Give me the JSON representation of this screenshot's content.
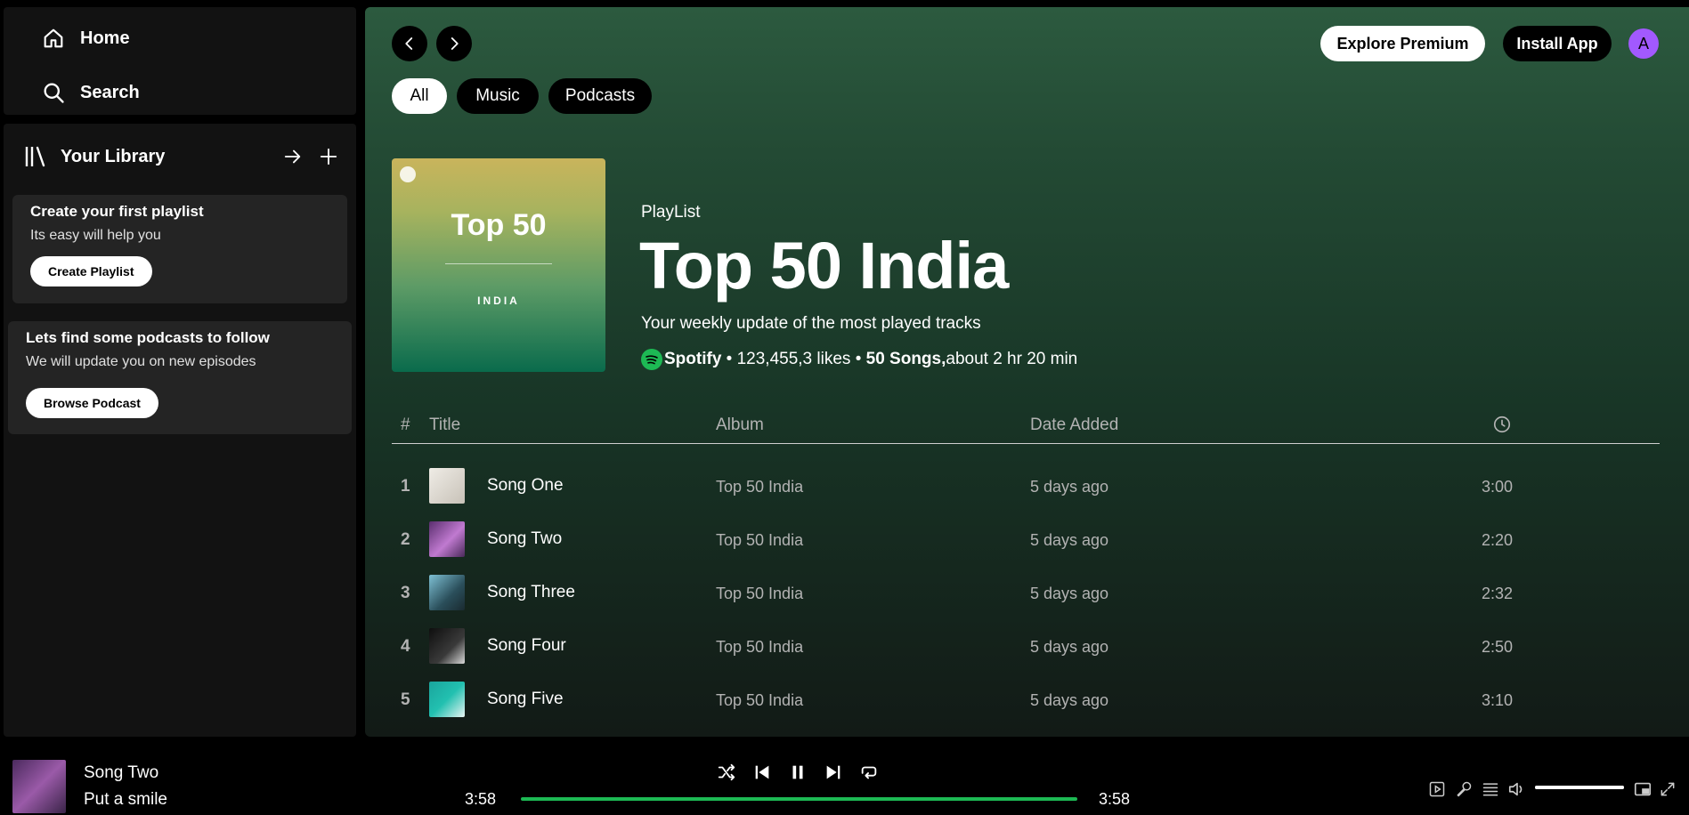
{
  "nav": {
    "home": "Home",
    "search": "Search"
  },
  "library": {
    "title": "Your Library",
    "playlist_card": {
      "title": "Create your first playlist",
      "subtitle": "Its easy will help you",
      "button": "Create Playlist"
    },
    "podcast_card": {
      "title": "Lets find some podcasts to follow",
      "subtitle": "We will update you on new episodes",
      "button": "Browse Podcast"
    }
  },
  "header": {
    "explore_premium": "Explore Premium",
    "install_app": "Install App",
    "avatar_initial": "A"
  },
  "filters": [
    "All",
    "Music",
    "Podcasts"
  ],
  "cover": {
    "title": "Top 50",
    "subtitle": "INDIA"
  },
  "playlist": {
    "type": "PlayList",
    "title": "Top 50 India",
    "description": "Your weekly update of the most played tracks",
    "owner": "Spotify",
    "likes": " • 123,455,3 likes • ",
    "song_count": "50 Songs,",
    "duration": "about 2 hr 20 min"
  },
  "table": {
    "headers": {
      "num": "#",
      "title": "Title",
      "album": "Album",
      "date": "Date Added"
    },
    "rows": [
      {
        "num": "1",
        "title": "Song One",
        "album": "Top 50 India",
        "date": "5 days ago",
        "duration": "3:00",
        "thumb_color": "#d8d4cf"
      },
      {
        "num": "2",
        "title": "Song Two",
        "album": "Top 50 India",
        "date": "5 days ago",
        "duration": "2:20",
        "thumb_color": "#9a5aa8"
      },
      {
        "num": "3",
        "title": "Song Three",
        "album": "Top 50 India",
        "date": "5 days ago",
        "duration": "2:32",
        "thumb_color": "#5aa0b8"
      },
      {
        "num": "4",
        "title": "Song Four",
        "album": "Top 50 India",
        "date": "5 days ago",
        "duration": "2:50",
        "thumb_color": "#1a1a1a"
      },
      {
        "num": "5",
        "title": "Song Five",
        "album": "Top 50 India",
        "date": "5 days ago",
        "duration": "3:10",
        "thumb_color": "#1ea8a0"
      }
    ]
  },
  "player": {
    "title": "Song Two",
    "artist": "Put a smile",
    "elapsed": "3:58",
    "total": "3:58",
    "progress": 1.0,
    "volume": 1.0
  },
  "colors": {
    "accent": "#1db954",
    "avatar": "#a259ff"
  }
}
